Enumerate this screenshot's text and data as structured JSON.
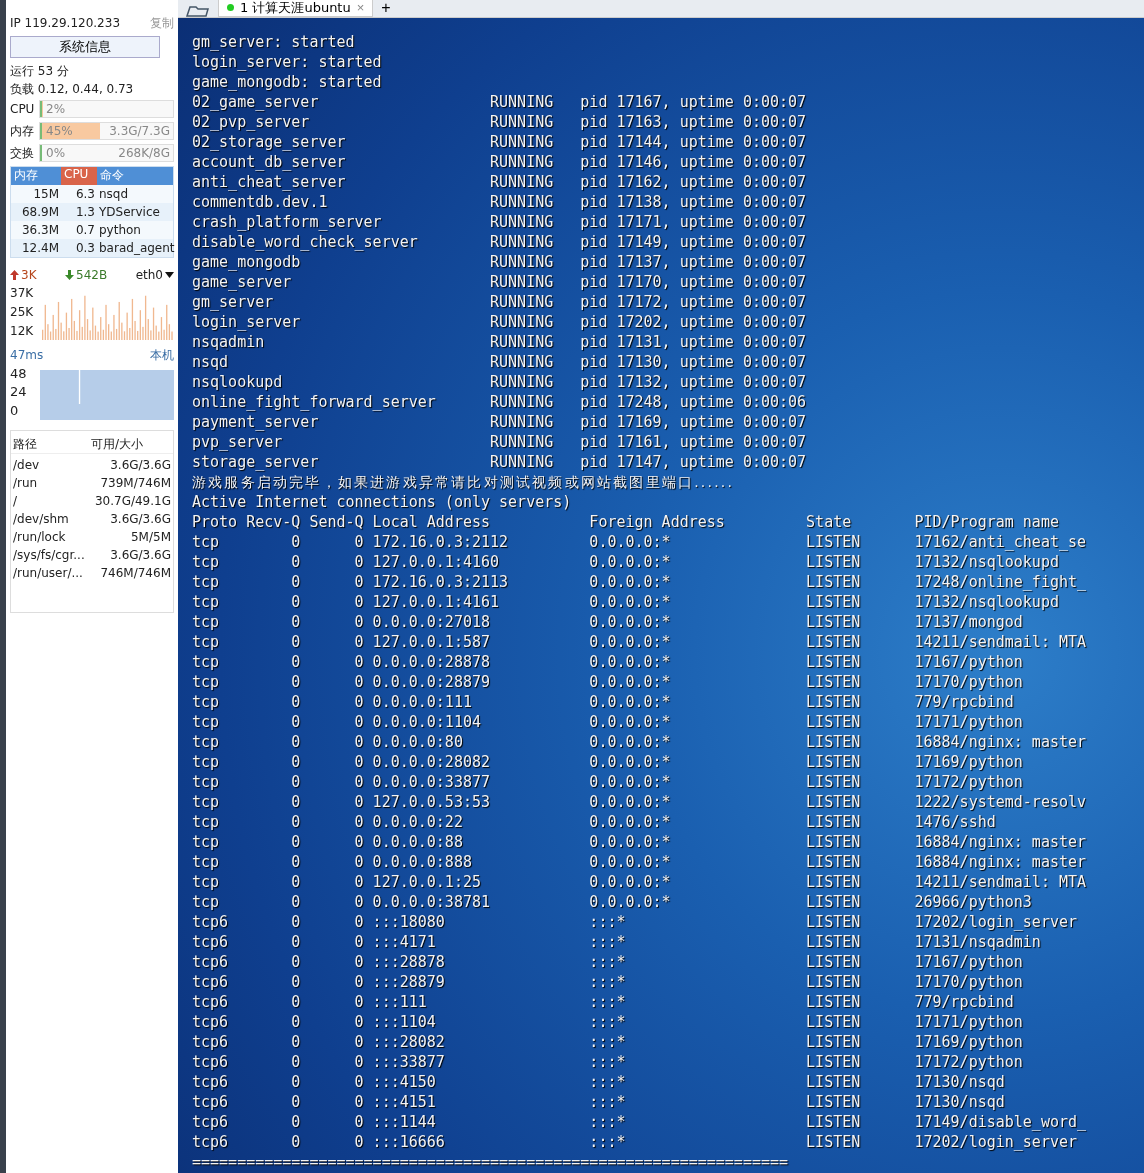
{
  "sidebar": {
    "ip_label": "IP",
    "ip": "119.29.120.233",
    "copy": "复制",
    "sysinfo_button": "系统信息",
    "uptime": "运行 53 分",
    "load": "负载 0.12, 0.44, 0.73",
    "meters": [
      {
        "label": "CPU",
        "value": "2%",
        "level": 0.02
      },
      {
        "label": "内存",
        "value": "45%",
        "detail": "3.3G/7.3G",
        "level": 0.45
      },
      {
        "label": "交换",
        "value": "0%",
        "detail": "268K/8G",
        "level": 0.0
      }
    ],
    "process_columns": [
      "内存",
      "CPU",
      "命令"
    ],
    "processes": [
      {
        "mem": "15M",
        "cpu": "6.3",
        "cmd": "nsqd"
      },
      {
        "mem": "68.9M",
        "cpu": "1.3",
        "cmd": "YDService"
      },
      {
        "mem": "36.3M",
        "cpu": "0.7",
        "cmd": "python"
      },
      {
        "mem": "12.4M",
        "cpu": "0.3",
        "cmd": "barad_agent"
      }
    ],
    "net": {
      "up": "3K",
      "down": "542B",
      "iface": "eth0",
      "yticks": [
        "37K",
        "25K",
        "12K"
      ]
    },
    "ping": {
      "latency": "47ms",
      "target": "本机",
      "yticks": [
        "48",
        "24",
        "0"
      ]
    },
    "disk_columns": [
      "路径",
      "可用/大小"
    ],
    "disks": [
      {
        "path": "/dev",
        "size": "3.6G/3.6G"
      },
      {
        "path": "/run",
        "size": "739M/746M"
      },
      {
        "path": "/",
        "size": "30.7G/49.1G"
      },
      {
        "path": "/dev/shm",
        "size": "3.6G/3.6G"
      },
      {
        "path": "/run/lock",
        "size": "5M/5M"
      },
      {
        "path": "/sys/fs/cgr...",
        "size": "3.6G/3.6G"
      },
      {
        "path": "/run/user/...",
        "size": "746M/746M"
      }
    ]
  },
  "tabs": [
    {
      "label": "1 计算天涯ubuntu",
      "selected": true,
      "close": "×"
    }
  ],
  "new_tab": "+",
  "terminal": {
    "started": [
      "gm_server: started",
      "login_server: started",
      "game_mongodb: started"
    ],
    "services": [
      {
        "name": "02_game_server",
        "state": "RUNNING",
        "info": "pid 17167, uptime 0:00:07"
      },
      {
        "name": "02_pvp_server",
        "state": "RUNNING",
        "info": "pid 17163, uptime 0:00:07"
      },
      {
        "name": "02_storage_server",
        "state": "RUNNING",
        "info": "pid 17144, uptime 0:00:07"
      },
      {
        "name": "account_db_server",
        "state": "RUNNING",
        "info": "pid 17146, uptime 0:00:07"
      },
      {
        "name": "anti_cheat_server",
        "state": "RUNNING",
        "info": "pid 17162, uptime 0:00:07"
      },
      {
        "name": "commentdb.dev.1",
        "state": "RUNNING",
        "info": "pid 17138, uptime 0:00:07"
      },
      {
        "name": "crash_platform_server",
        "state": "RUNNING",
        "info": "pid 17171, uptime 0:00:07"
      },
      {
        "name": "disable_word_check_server",
        "state": "RUNNING",
        "info": "pid 17149, uptime 0:00:07"
      },
      {
        "name": "game_mongodb",
        "state": "RUNNING",
        "info": "pid 17137, uptime 0:00:07"
      },
      {
        "name": "game_server",
        "state": "RUNNING",
        "info": "pid 17170, uptime 0:00:07"
      },
      {
        "name": "gm_server",
        "state": "RUNNING",
        "info": "pid 17172, uptime 0:00:07"
      },
      {
        "name": "login_server",
        "state": "RUNNING",
        "info": "pid 17202, uptime 0:00:07"
      },
      {
        "name": "nsqadmin",
        "state": "RUNNING",
        "info": "pid 17131, uptime 0:00:07"
      },
      {
        "name": "nsqd",
        "state": "RUNNING",
        "info": "pid 17130, uptime 0:00:07"
      },
      {
        "name": "nsqlookupd",
        "state": "RUNNING",
        "info": "pid 17132, uptime 0:00:07"
      },
      {
        "name": "online_fight_forward_server",
        "state": "RUNNING",
        "info": "pid 17248, uptime 0:00:06"
      },
      {
        "name": "payment_server",
        "state": "RUNNING",
        "info": "pid 17169, uptime 0:00:07"
      },
      {
        "name": "pvp_server",
        "state": "RUNNING",
        "info": "pid 17161, uptime 0:00:07"
      },
      {
        "name": "storage_server",
        "state": "RUNNING",
        "info": "pid 17147, uptime 0:00:07"
      }
    ],
    "message": "游戏服务启动完毕，如果进游戏异常请比对测试视频或网站截图里端口......",
    "netstat_title": "Active Internet connections (only servers)",
    "netstat_columns": [
      "Proto",
      "Recv-Q",
      "Send-Q",
      "Local Address",
      "Foreign Address",
      "State",
      "PID/Program name"
    ],
    "connections": [
      [
        "tcp",
        "0",
        "0",
        "172.16.0.3:2112",
        "0.0.0.0:*",
        "LISTEN",
        "17162/anti_cheat_se"
      ],
      [
        "tcp",
        "0",
        "0",
        "127.0.0.1:4160",
        "0.0.0.0:*",
        "LISTEN",
        "17132/nsqlookupd"
      ],
      [
        "tcp",
        "0",
        "0",
        "172.16.0.3:2113",
        "0.0.0.0:*",
        "LISTEN",
        "17248/online_fight_"
      ],
      [
        "tcp",
        "0",
        "0",
        "127.0.0.1:4161",
        "0.0.0.0:*",
        "LISTEN",
        "17132/nsqlookupd"
      ],
      [
        "tcp",
        "0",
        "0",
        "0.0.0.0:27018",
        "0.0.0.0:*",
        "LISTEN",
        "17137/mongod"
      ],
      [
        "tcp",
        "0",
        "0",
        "127.0.0.1:587",
        "0.0.0.0:*",
        "LISTEN",
        "14211/sendmail: MTA"
      ],
      [
        "tcp",
        "0",
        "0",
        "0.0.0.0:28878",
        "0.0.0.0:*",
        "LISTEN",
        "17167/python"
      ],
      [
        "tcp",
        "0",
        "0",
        "0.0.0.0:28879",
        "0.0.0.0:*",
        "LISTEN",
        "17170/python"
      ],
      [
        "tcp",
        "0",
        "0",
        "0.0.0.0:111",
        "0.0.0.0:*",
        "LISTEN",
        "779/rpcbind"
      ],
      [
        "tcp",
        "0",
        "0",
        "0.0.0.0:1104",
        "0.0.0.0:*",
        "LISTEN",
        "17171/python"
      ],
      [
        "tcp",
        "0",
        "0",
        "0.0.0.0:80",
        "0.0.0.0:*",
        "LISTEN",
        "16884/nginx: master"
      ],
      [
        "tcp",
        "0",
        "0",
        "0.0.0.0:28082",
        "0.0.0.0:*",
        "LISTEN",
        "17169/python"
      ],
      [
        "tcp",
        "0",
        "0",
        "0.0.0.0:33877",
        "0.0.0.0:*",
        "LISTEN",
        "17172/python"
      ],
      [
        "tcp",
        "0",
        "0",
        "127.0.0.53:53",
        "0.0.0.0:*",
        "LISTEN",
        "1222/systemd-resolv"
      ],
      [
        "tcp",
        "0",
        "0",
        "0.0.0.0:22",
        "0.0.0.0:*",
        "LISTEN",
        "1476/sshd"
      ],
      [
        "tcp",
        "0",
        "0",
        "0.0.0.0:88",
        "0.0.0.0:*",
        "LISTEN",
        "16884/nginx: master"
      ],
      [
        "tcp",
        "0",
        "0",
        "0.0.0.0:888",
        "0.0.0.0:*",
        "LISTEN",
        "16884/nginx: master"
      ],
      [
        "tcp",
        "0",
        "0",
        "127.0.0.1:25",
        "0.0.0.0:*",
        "LISTEN",
        "14211/sendmail: MTA"
      ],
      [
        "tcp",
        "0",
        "0",
        "0.0.0.0:38781",
        "0.0.0.0:*",
        "LISTEN",
        "26966/python3"
      ],
      [
        "tcp6",
        "0",
        "0",
        ":::18080",
        ":::*",
        "LISTEN",
        "17202/login_server"
      ],
      [
        "tcp6",
        "0",
        "0",
        ":::4171",
        ":::*",
        "LISTEN",
        "17131/nsqadmin"
      ],
      [
        "tcp6",
        "0",
        "0",
        ":::28878",
        ":::*",
        "LISTEN",
        "17167/python"
      ],
      [
        "tcp6",
        "0",
        "0",
        ":::28879",
        ":::*",
        "LISTEN",
        "17170/python"
      ],
      [
        "tcp6",
        "0",
        "0",
        ":::111",
        ":::*",
        "LISTEN",
        "779/rpcbind"
      ],
      [
        "tcp6",
        "0",
        "0",
        ":::1104",
        ":::*",
        "LISTEN",
        "17171/python"
      ],
      [
        "tcp6",
        "0",
        "0",
        ":::28082",
        ":::*",
        "LISTEN",
        "17169/python"
      ],
      [
        "tcp6",
        "0",
        "0",
        ":::33877",
        ":::*",
        "LISTEN",
        "17172/python"
      ],
      [
        "tcp6",
        "0",
        "0",
        ":::4150",
        ":::*",
        "LISTEN",
        "17130/nsqd"
      ],
      [
        "tcp6",
        "0",
        "0",
        ":::4151",
        ":::*",
        "LISTEN",
        "17130/nsqd"
      ],
      [
        "tcp6",
        "0",
        "0",
        ":::1144",
        ":::*",
        "LISTEN",
        "17149/disable_word_"
      ],
      [
        "tcp6",
        "0",
        "0",
        ":::16666",
        ":::*",
        "LISTEN",
        "17202/login_server"
      ]
    ],
    "separator": "=================================================================="
  }
}
